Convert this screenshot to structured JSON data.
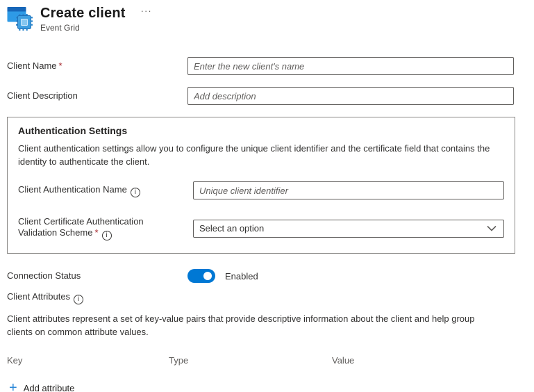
{
  "header": {
    "title": "Create client",
    "subtitle": "Event Grid",
    "more_label": "···"
  },
  "form": {
    "client_name": {
      "label": "Client Name",
      "required": "*",
      "placeholder": "Enter the new client's name"
    },
    "client_description": {
      "label": "Client Description",
      "placeholder": "Add description"
    },
    "auth": {
      "title": "Authentication Settings",
      "description": "Client authentication settings allow you to configure the unique client identifier and the certificate field that contains the identity to authenticate the client.",
      "auth_name": {
        "label": "Client Authentication Name",
        "info": "i",
        "placeholder": "Unique client identifier"
      },
      "validation_scheme": {
        "label": "Client Certificate Authentication Validation Scheme",
        "required": "*",
        "info": "i",
        "value": "Select an option"
      }
    },
    "connection_status": {
      "label": "Connection Status",
      "state": "Enabled"
    },
    "attributes": {
      "label": "Client Attributes",
      "info": "i",
      "description": "Client attributes represent a set of key-value pairs that provide descriptive information about the client and help group clients on common attribute values.",
      "columns": [
        "Key",
        "Type",
        "Value"
      ],
      "add_button": "Add attribute"
    }
  },
  "colors": {
    "accent": "#0078d4",
    "required": "#a4262c"
  }
}
